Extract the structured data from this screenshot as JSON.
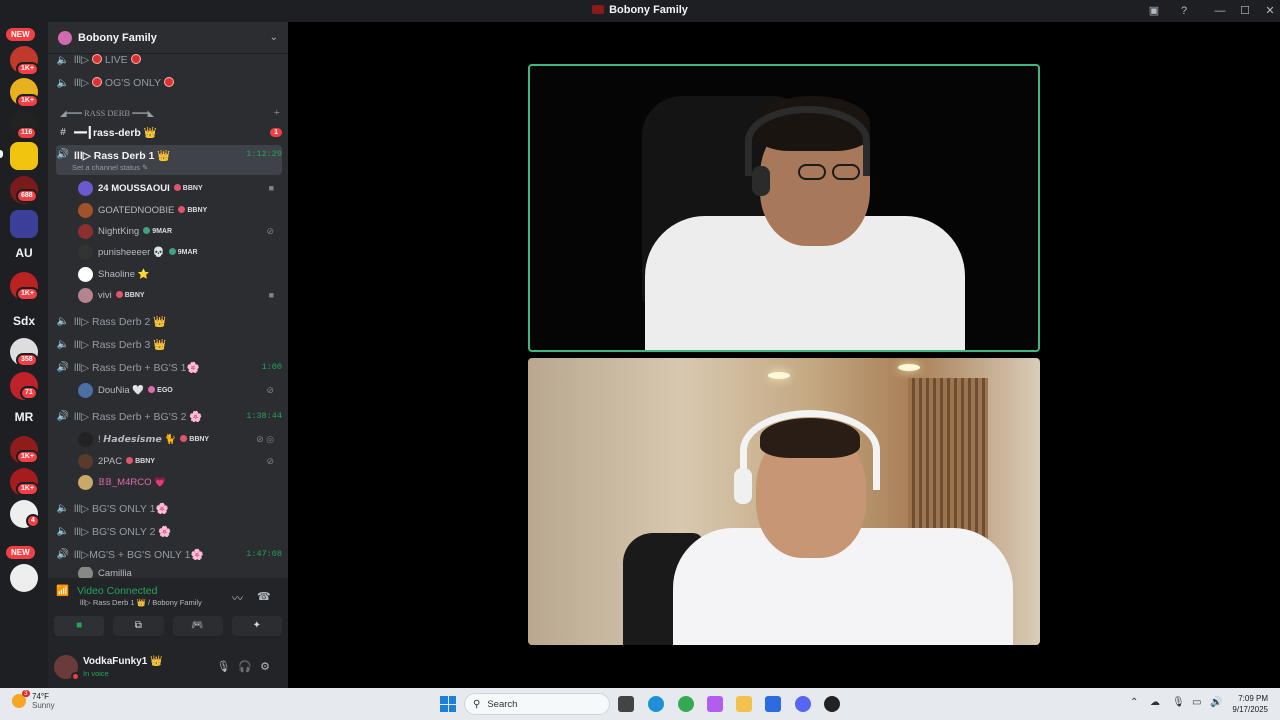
{
  "window": {
    "title": "Bobony Family"
  },
  "rail": {
    "new_top": "NEW",
    "new_bottom": "NEW",
    "badges": [
      "1K+",
      "1K+",
      "116",
      "688",
      "1K+",
      "358",
      "71",
      "1K+",
      "1K+",
      "4"
    ],
    "text_servers": [
      "AU",
      "Sdx",
      "MR"
    ]
  },
  "guild": {
    "name": "Bobony Family"
  },
  "channels": {
    "live": "lll▷",
    "live_label": "LIVE",
    "og_prefix": "lll▷",
    "og_label": "OG'S ONLY",
    "category": "◢━━━ RASS DERB ━━━◣",
    "text_channel": "━━┃rass-derb 👑",
    "text_unread": "1",
    "active": {
      "name": "lll▷ Rass Derb 1 👑",
      "timer": "1:12:29",
      "status": "Set a channel status ✎"
    },
    "rd2": "lll▷ Rass Derb 2 👑",
    "rd3": "lll▷ Rass Derb 3 👑",
    "bg1": {
      "name": "lll▷ Rass Derb + BG'S 1🌸",
      "timer": "1:00"
    },
    "bg2": {
      "name": "lll▷ Rass Derb + BG'S 2 🌸",
      "timer": "1:38:44"
    },
    "bgonly1": "lll▷ BG'S ONLY 1🌸",
    "bgonly2": "lll▷ BG'S ONLY 2 🌸",
    "mgbg": {
      "name": "lll▷MG'S + BG'S ONLY 1🌸",
      "timer": "1:47:08"
    }
  },
  "users": {
    "u1": {
      "name": "24 MOUSSAOUI",
      "tag": "BBNY"
    },
    "u2": {
      "name": "GOATEDNOOBIE",
      "tag": "BBNY"
    },
    "u3": {
      "name": "NightKing",
      "tag": "9MAR"
    },
    "u4": {
      "name": "punisheeeer 💀",
      "tag": "9MAR"
    },
    "u5": {
      "name": "Shaoline ⭐",
      "tag": ""
    },
    "u6": {
      "name": "vivi",
      "tag": "BBNY"
    },
    "u7": {
      "name": "DouNia 🤍",
      "tag": "EGO"
    },
    "u8": {
      "name": "! 𝙃𝙖𝙙𝙚𝙨𝙞𝙨𝙢𝙚 🐈",
      "tag": "BBNY"
    },
    "u9": {
      "name": "2PAC",
      "tag": "BBNY"
    },
    "u10": {
      "name": "𝔹𝔹_M4RCO 💗",
      "tag": ""
    },
    "u11": {
      "name": "Camillia",
      "tag": ""
    }
  },
  "voice": {
    "status": "Video Connected",
    "sub": "lll▷ Rass Derb 1 👑 / Bobony Family"
  },
  "userbar": {
    "name": "VodkaFunky1 👑",
    "state": "In voice"
  },
  "taskbar": {
    "temp": "74°F",
    "cond": "Sunny",
    "weather_badge": "3",
    "search": "Search",
    "time": "7:09 PM",
    "date": "9/17/2025"
  }
}
